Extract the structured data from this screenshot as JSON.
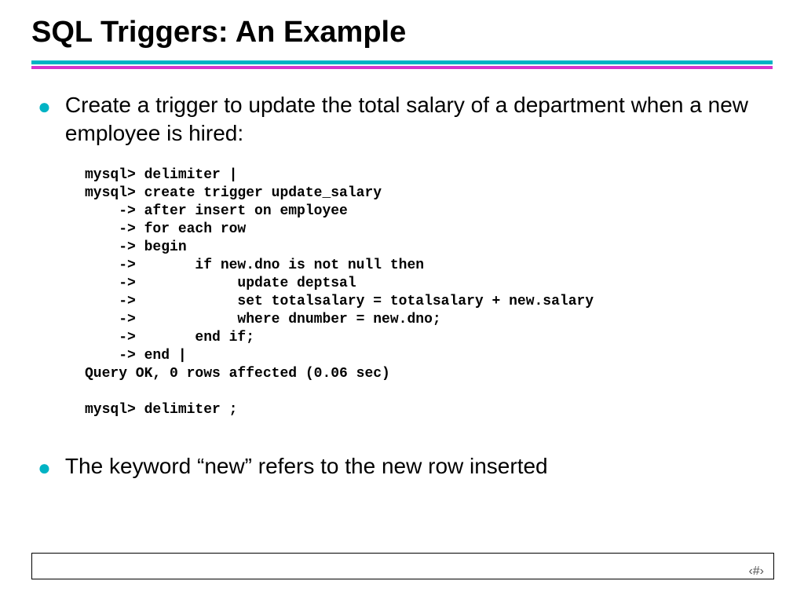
{
  "title": "SQL Triggers: An Example",
  "bullets": [
    "Create a trigger to update the total salary of a department when a new employee is hired:",
    "The keyword “new” refers to the new row inserted"
  ],
  "code": "mysql> delimiter |\nmysql> create trigger update_salary\n    -> after insert on employee\n    -> for each row\n    -> begin\n    ->       if new.dno is not null then\n    ->            update deptsal\n    ->            set totalsalary = totalsalary + new.salary\n    ->            where dnumber = new.dno;\n    ->       end if;\n    -> end |\nQuery OK, 0 rows affected (0.06 sec)\n\nmysql> delimiter ;",
  "page_marker": "‹#›"
}
